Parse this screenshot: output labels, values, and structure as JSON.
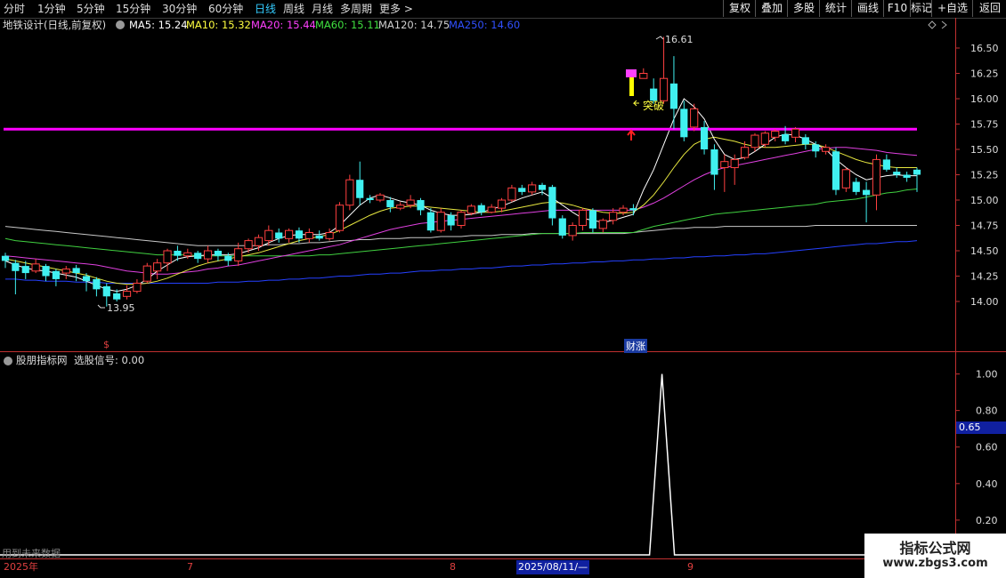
{
  "toolbar": {
    "timeframes": [
      "分时",
      "1分钟",
      "5分钟",
      "15分钟",
      "30分钟",
      "60分钟",
      "日线",
      "周线",
      "月线",
      "多周期",
      "更多 >"
    ],
    "active": "日线",
    "right_buttons": [
      "复权",
      "叠加",
      "多股",
      "统计",
      "画线",
      "F10",
      "+自选",
      "返回"
    ]
  },
  "main_legend": {
    "title": "地铁设计(日线,前复权)",
    "ma": [
      {
        "label": "MA5: 15.24",
        "color": "#ffffff"
      },
      {
        "label": "MA10: 15.32",
        "color": "#ffff40"
      },
      {
        "label": "MA20: 15.44",
        "color": "#ff40ff"
      },
      {
        "label": "MA60: 15.11",
        "color": "#40e040"
      },
      {
        "label": "MA120: 14.75",
        "color": "#d0d0d0"
      },
      {
        "label": "MA250: 14.60",
        "color": "#3050ff"
      }
    ]
  },
  "indicator_legend": {
    "title": "股朋指标网",
    "signal": "选股信号: 0.00"
  },
  "price_axis": [
    "16.50",
    "16.25",
    "16.00",
    "15.75",
    "15.50",
    "15.25",
    "15.00",
    "14.75",
    "14.50",
    "14.25",
    "14.00"
  ],
  "indicator_axis": [
    "1.00",
    "0.80",
    "0.60",
    "0.40",
    "0.20"
  ],
  "indicator_cursor": "0.65",
  "annotations": {
    "high": "16.61",
    "low": "13.95",
    "breakout": "突破",
    "cai_zhang": "财涨",
    "future_data": "用到未来数据",
    "dollar_marker": "$"
  },
  "date_axis": {
    "year": "2025年",
    "m7": "7",
    "m8": "8",
    "selected": "2025/08/11/—",
    "m9": "9"
  },
  "watermark": {
    "line1": "指标公式网",
    "line2": "www.zbgs3.com"
  },
  "colors": {
    "up": "#ff4040",
    "down": "#40f0f0",
    "breakout_line": "#ff00ff",
    "axis": "#c03030"
  },
  "chart_data": {
    "type": "candlestick",
    "ylim": [
      13.75,
      16.75
    ],
    "candles": [
      [
        14.45,
        14.4,
        14.48,
        14.33
      ],
      [
        14.38,
        14.3,
        14.41,
        14.07
      ],
      [
        14.35,
        14.28,
        14.4,
        14.22
      ],
      [
        14.3,
        14.37,
        14.42,
        14.28
      ],
      [
        14.35,
        14.25,
        14.37,
        14.2
      ],
      [
        14.3,
        14.22,
        14.32,
        14.15
      ],
      [
        14.28,
        14.32,
        14.35,
        14.22
      ],
      [
        14.33,
        14.28,
        14.36,
        14.2
      ],
      [
        14.25,
        14.2,
        14.28,
        14.1
      ],
      [
        14.22,
        14.12,
        14.24,
        14.05
      ],
      [
        14.15,
        14.05,
        14.18,
        13.95
      ],
      [
        14.08,
        14.02,
        14.12,
        14.0
      ],
      [
        14.05,
        14.1,
        14.16,
        14.02
      ],
      [
        14.1,
        14.18,
        14.22,
        14.08
      ],
      [
        14.2,
        14.35,
        14.38,
        14.18
      ],
      [
        14.3,
        14.38,
        14.42,
        14.22
      ],
      [
        14.38,
        14.5,
        14.52,
        14.3
      ],
      [
        14.5,
        14.45,
        14.55,
        14.4
      ],
      [
        14.45,
        14.48,
        14.52,
        14.42
      ],
      [
        14.48,
        14.42,
        14.5,
        14.38
      ],
      [
        14.42,
        14.5,
        14.55,
        14.38
      ],
      [
        14.5,
        14.45,
        14.52,
        14.4
      ],
      [
        14.45,
        14.4,
        14.48,
        14.35
      ],
      [
        14.4,
        14.52,
        14.58,
        14.35
      ],
      [
        14.52,
        14.6,
        14.62,
        14.48
      ],
      [
        14.55,
        14.63,
        14.66,
        14.5
      ],
      [
        14.6,
        14.7,
        14.75,
        14.55
      ],
      [
        14.68,
        14.62,
        14.72,
        14.58
      ],
      [
        14.62,
        14.7,
        14.72,
        14.58
      ],
      [
        14.7,
        14.62,
        14.73,
        14.58
      ],
      [
        14.62,
        14.68,
        14.72,
        14.58
      ],
      [
        14.65,
        14.62,
        14.7,
        14.6
      ],
      [
        14.62,
        14.68,
        14.72,
        14.6
      ],
      [
        14.7,
        14.95,
        14.98,
        14.68
      ],
      [
        14.95,
        15.2,
        15.25,
        14.9
      ],
      [
        15.2,
        15.02,
        15.38,
        14.95
      ],
      [
        15.02,
        15.0,
        15.05,
        14.97
      ],
      [
        15.0,
        15.05,
        15.07,
        14.98
      ],
      [
        15.0,
        14.93,
        15.03,
        14.88
      ],
      [
        14.92,
        14.95,
        14.98,
        14.9
      ],
      [
        14.95,
        15.0,
        15.05,
        14.92
      ],
      [
        15.0,
        14.9,
        15.02,
        14.85
      ],
      [
        14.88,
        14.7,
        14.92,
        14.68
      ],
      [
        14.7,
        14.88,
        14.92,
        14.68
      ],
      [
        14.85,
        14.75,
        14.88,
        14.7
      ],
      [
        14.75,
        14.88,
        14.9,
        14.72
      ],
      [
        14.87,
        14.94,
        14.96,
        14.85
      ],
      [
        14.95,
        14.88,
        14.97,
        14.85
      ],
      [
        14.88,
        14.93,
        14.96,
        14.87
      ],
      [
        14.92,
        15.0,
        15.02,
        14.88
      ],
      [
        15.0,
        15.12,
        15.15,
        14.98
      ],
      [
        15.12,
        15.08,
        15.15,
        15.05
      ],
      [
        15.08,
        15.15,
        15.18,
        15.05
      ],
      [
        15.15,
        15.1,
        15.17,
        15.05
      ],
      [
        15.13,
        14.82,
        15.15,
        14.75
      ],
      [
        14.82,
        14.65,
        14.85,
        14.62
      ],
      [
        14.65,
        14.75,
        14.78,
        14.6
      ],
      [
        14.75,
        14.9,
        14.92,
        14.7
      ],
      [
        14.9,
        14.72,
        14.92,
        14.68
      ],
      [
        14.72,
        14.8,
        14.82,
        14.68
      ],
      [
        14.8,
        14.88,
        14.92,
        14.76
      ],
      [
        14.88,
        14.92,
        14.95,
        14.85
      ],
      [
        14.92,
        14.9,
        14.96,
        14.85
      ],
      [
        16.2,
        16.25,
        16.3,
        16.2
      ],
      [
        16.1,
        15.98,
        16.2,
        15.95
      ],
      [
        15.98,
        16.2,
        16.61,
        15.95
      ],
      [
        16.15,
        15.9,
        16.42,
        15.7
      ],
      [
        15.9,
        15.62,
        15.98,
        15.58
      ],
      [
        15.72,
        15.9,
        15.95,
        15.68
      ],
      [
        15.72,
        15.5,
        15.78,
        15.45
      ],
      [
        15.5,
        15.25,
        15.55,
        15.1
      ],
      [
        15.32,
        15.38,
        15.45,
        15.08
      ],
      [
        15.32,
        15.4,
        15.45,
        15.15
      ],
      [
        15.42,
        15.52,
        15.58,
        15.4
      ],
      [
        15.52,
        15.64,
        15.66,
        15.48
      ],
      [
        15.55,
        15.66,
        15.68,
        15.52
      ],
      [
        15.62,
        15.68,
        15.7,
        15.58
      ],
      [
        15.65,
        15.58,
        15.73,
        15.55
      ],
      [
        15.62,
        15.7,
        15.72,
        15.57
      ],
      [
        15.62,
        15.55,
        15.65,
        15.5
      ],
      [
        15.55,
        15.48,
        15.58,
        15.42
      ],
      [
        15.48,
        15.52,
        15.55,
        15.45
      ],
      [
        15.48,
        15.1,
        15.52,
        15.05
      ],
      [
        15.12,
        15.3,
        15.32,
        15.08
      ],
      [
        15.18,
        15.08,
        15.22,
        15.05
      ],
      [
        15.1,
        15.05,
        15.18,
        14.78
      ],
      [
        15.05,
        15.4,
        15.45,
        14.9
      ],
      [
        15.4,
        15.3,
        15.45,
        15.28
      ],
      [
        15.28,
        15.25,
        15.32,
        15.22
      ],
      [
        15.25,
        15.22,
        15.28,
        15.18
      ],
      [
        15.3,
        15.25,
        15.32,
        15.08
      ]
    ],
    "ma5": [
      14.4,
      14.36,
      14.33,
      14.31,
      14.3,
      14.28,
      14.26,
      14.24,
      14.2,
      14.16,
      14.12,
      14.1,
      14.12,
      14.16,
      14.22,
      14.3,
      14.36,
      14.42,
      14.44,
      14.45,
      14.46,
      14.46,
      14.46,
      14.47,
      14.5,
      14.53,
      14.58,
      14.62,
      14.65,
      14.66,
      14.66,
      14.66,
      14.68,
      14.75,
      14.85,
      14.95,
      15.02,
      15.05,
      15.02,
      14.99,
      14.97,
      14.95,
      14.9,
      14.87,
      14.85,
      14.85,
      14.86,
      14.88,
      14.91,
      14.94,
      14.98,
      15.02,
      15.05,
      15.08,
      15.02,
      14.95,
      14.88,
      14.82,
      14.8,
      14.78,
      14.8,
      14.83,
      14.86,
      15.1,
      15.3,
      15.55,
      15.8,
      16.0,
      15.92,
      15.8,
      15.6,
      15.45,
      15.4,
      15.42,
      15.48,
      15.55,
      15.62,
      15.65,
      15.64,
      15.6,
      15.55,
      15.5,
      15.4,
      15.32,
      15.25,
      15.2,
      15.22,
      15.24,
      15.25,
      15.24,
      15.24
    ],
    "ma10": [
      14.42,
      14.4,
      14.38,
      14.36,
      14.34,
      14.32,
      14.3,
      14.28,
      14.26,
      14.23,
      14.2,
      14.18,
      14.17,
      14.17,
      14.18,
      14.2,
      14.23,
      14.27,
      14.31,
      14.35,
      14.38,
      14.4,
      14.42,
      14.44,
      14.46,
      14.48,
      14.51,
      14.54,
      14.57,
      14.6,
      14.62,
      14.64,
      14.66,
      14.7,
      14.75,
      14.8,
      14.85,
      14.89,
      14.92,
      14.93,
      14.94,
      14.94,
      14.93,
      14.92,
      14.91,
      14.9,
      14.89,
      14.88,
      14.88,
      14.89,
      14.91,
      14.93,
      14.95,
      14.97,
      14.98,
      14.97,
      14.95,
      14.92,
      14.9,
      14.88,
      14.87,
      14.87,
      14.88,
      14.95,
      15.05,
      15.18,
      15.32,
      15.45,
      15.55,
      15.6,
      15.62,
      15.6,
      15.58,
      15.55,
      15.53,
      15.52,
      15.52,
      15.53,
      15.54,
      15.55,
      15.55,
      15.52,
      15.48,
      15.44,
      15.4,
      15.37,
      15.35,
      15.33,
      15.32,
      15.32,
      15.32
    ],
    "ma20": [
      14.45,
      14.44,
      14.43,
      14.42,
      14.41,
      14.4,
      14.39,
      14.38,
      14.37,
      14.36,
      14.34,
      14.32,
      14.3,
      14.29,
      14.28,
      14.27,
      14.27,
      14.28,
      14.29,
      14.3,
      14.32,
      14.33,
      14.35,
      14.36,
      14.38,
      14.4,
      14.42,
      14.44,
      14.46,
      14.48,
      14.5,
      14.52,
      14.54,
      14.56,
      14.59,
      14.62,
      14.65,
      14.68,
      14.71,
      14.73,
      14.75,
      14.77,
      14.78,
      14.79,
      14.8,
      14.81,
      14.82,
      14.83,
      14.84,
      14.85,
      14.86,
      14.87,
      14.88,
      14.89,
      14.9,
      14.9,
      14.9,
      14.9,
      14.9,
      14.9,
      14.9,
      14.9,
      14.9,
      14.93,
      14.97,
      15.02,
      15.08,
      15.14,
      15.2,
      15.25,
      15.29,
      15.32,
      15.34,
      15.36,
      15.38,
      15.4,
      15.42,
      15.44,
      15.46,
      15.48,
      15.5,
      15.51,
      15.52,
      15.52,
      15.51,
      15.5,
      15.49,
      15.47,
      15.46,
      15.45,
      15.44
    ],
    "ma60": [
      14.62,
      14.6,
      14.59,
      14.58,
      14.57,
      14.56,
      14.55,
      14.54,
      14.53,
      14.52,
      14.51,
      14.5,
      14.49,
      14.48,
      14.47,
      14.46,
      14.46,
      14.46,
      14.46,
      14.45,
      14.45,
      14.45,
      14.45,
      14.45,
      14.45,
      14.45,
      14.45,
      14.45,
      14.45,
      14.45,
      14.45,
      14.46,
      14.46,
      14.47,
      14.48,
      14.49,
      14.5,
      14.51,
      14.52,
      14.53,
      14.54,
      14.55,
      14.56,
      14.57,
      14.58,
      14.59,
      14.6,
      14.61,
      14.62,
      14.63,
      14.64,
      14.65,
      14.66,
      14.67,
      14.67,
      14.67,
      14.67,
      14.68,
      14.68,
      14.68,
      14.68,
      14.68,
      14.68,
      14.71,
      14.74,
      14.76,
      14.78,
      14.8,
      14.82,
      14.84,
      14.86,
      14.87,
      14.88,
      14.89,
      14.9,
      14.91,
      14.92,
      14.93,
      14.94,
      14.95,
      14.96,
      14.98,
      14.99,
      15.0,
      15.01,
      15.03,
      15.05,
      15.07,
      15.08,
      15.1,
      15.11
    ],
    "ma120": [
      14.74,
      14.73,
      14.72,
      14.71,
      14.7,
      14.69,
      14.68,
      14.67,
      14.66,
      14.65,
      14.64,
      14.63,
      14.62,
      14.61,
      14.6,
      14.59,
      14.58,
      14.57,
      14.56,
      14.55,
      14.55,
      14.55,
      14.55,
      14.55,
      14.55,
      14.55,
      14.56,
      14.56,
      14.57,
      14.57,
      14.58,
      14.58,
      14.59,
      14.6,
      14.6,
      14.61,
      14.61,
      14.62,
      14.62,
      14.62,
      14.63,
      14.63,
      14.63,
      14.64,
      14.64,
      14.64,
      14.65,
      14.65,
      14.65,
      14.66,
      14.66,
      14.66,
      14.67,
      14.67,
      14.67,
      14.67,
      14.67,
      14.67,
      14.67,
      14.67,
      14.67,
      14.67,
      14.68,
      14.69,
      14.7,
      14.71,
      14.72,
      14.72,
      14.73,
      14.73,
      14.73,
      14.74,
      14.74,
      14.74,
      14.74,
      14.74,
      14.74,
      14.74,
      14.74,
      14.74,
      14.75,
      14.75,
      14.75,
      14.75,
      14.75,
      14.75,
      14.75,
      14.75,
      14.75,
      14.75,
      14.75
    ],
    "ma250": [
      14.22,
      14.22,
      14.21,
      14.21,
      14.2,
      14.2,
      14.2,
      14.19,
      14.19,
      14.19,
      14.18,
      14.18,
      14.18,
      14.18,
      14.18,
      14.18,
      14.18,
      14.18,
      14.18,
      14.18,
      14.18,
      14.19,
      14.19,
      14.19,
      14.2,
      14.2,
      14.21,
      14.21,
      14.22,
      14.22,
      14.23,
      14.23,
      14.24,
      14.25,
      14.25,
      14.26,
      14.27,
      14.27,
      14.28,
      14.28,
      14.29,
      14.3,
      14.3,
      14.31,
      14.31,
      14.32,
      14.32,
      14.33,
      14.33,
      14.34,
      14.35,
      14.35,
      14.36,
      14.36,
      14.37,
      14.37,
      14.38,
      14.38,
      14.39,
      14.39,
      14.4,
      14.4,
      14.41,
      14.41,
      14.42,
      14.42,
      14.43,
      14.43,
      14.44,
      14.44,
      14.45,
      14.45,
      14.46,
      14.46,
      14.47,
      14.47,
      14.48,
      14.49,
      14.5,
      14.51,
      14.52,
      14.53,
      14.54,
      14.55,
      14.56,
      14.57,
      14.57,
      14.58,
      14.59,
      14.59,
      14.6
    ],
    "breakout_level": 15.7,
    "signal": {
      "ylim": [
        0.0,
        1.1
      ],
      "spike_index": 65,
      "spike_value": 1.0
    }
  }
}
